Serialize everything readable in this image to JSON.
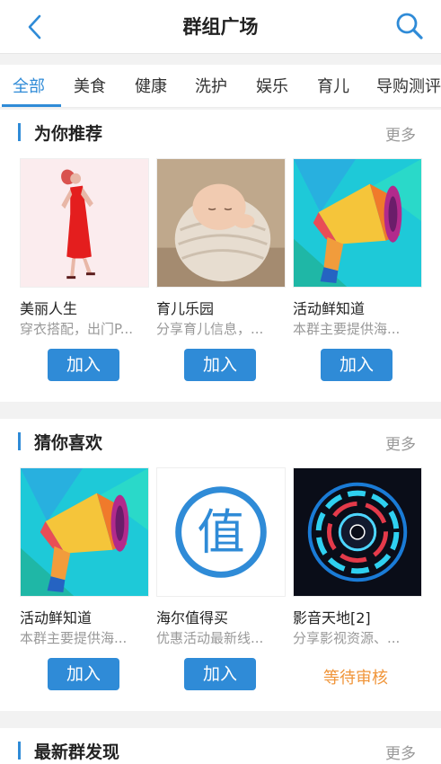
{
  "header": {
    "title": "群组广场"
  },
  "tabs": [
    {
      "label": "全部",
      "active": true
    },
    {
      "label": "美食"
    },
    {
      "label": "健康"
    },
    {
      "label": "洗护"
    },
    {
      "label": "娱乐"
    },
    {
      "label": "育儿"
    },
    {
      "label": "导购测评"
    }
  ],
  "sections": [
    {
      "title": "为你推荐",
      "more": "更多",
      "cards": [
        {
          "name": "美丽人生",
          "desc": "穿衣搭配，出门P...",
          "action": "加入",
          "image": "fashion-model-image"
        },
        {
          "name": "育儿乐园",
          "desc": "分享育儿信息，...",
          "action": "加入",
          "image": "baby-image"
        },
        {
          "name": "活动鲜知道",
          "desc": "本群主要提供海...",
          "action": "加入",
          "image": "megaphone-image"
        }
      ]
    },
    {
      "title": "猜你喜欢",
      "more": "更多",
      "cards": [
        {
          "name": "活动鲜知道",
          "desc": "本群主要提供海...",
          "action": "加入",
          "image": "megaphone-image"
        },
        {
          "name": "海尔值得买",
          "desc": "优惠活动最新线...",
          "action": "加入",
          "image": "zhi-logo-image"
        },
        {
          "name": "影音天地[2]",
          "desc": "分享影视资源、...",
          "status": "等待审核",
          "image": "speaker-image"
        }
      ]
    },
    {
      "title": "最新群发现",
      "more": "更多"
    }
  ],
  "colors": {
    "accent": "#2f8bd7",
    "pending": "#f0953a",
    "muted": "#999999"
  }
}
